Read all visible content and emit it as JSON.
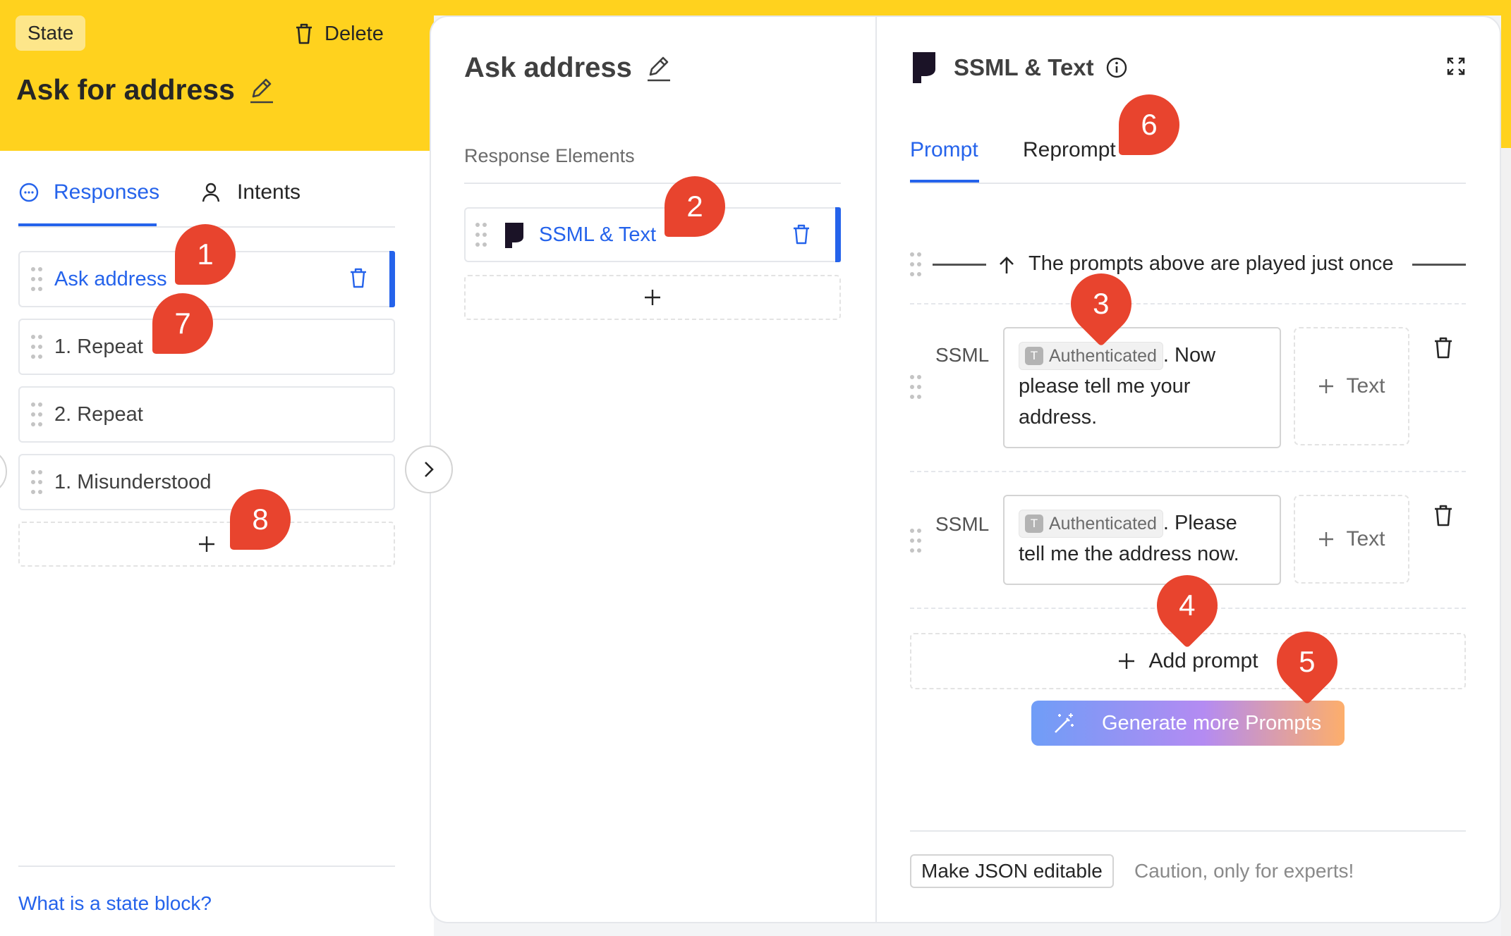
{
  "colors": {
    "yellow": "#ffd21e",
    "blue": "#2563eb",
    "red_pin": "#e8442e",
    "gradient_start": "#6f9df7",
    "gradient_mid": "#b48bf2",
    "gradient_end": "#fdae6b"
  },
  "left": {
    "badge": "State",
    "delete_label": "Delete",
    "title": "Ask for address",
    "tabs": [
      {
        "label": "Responses",
        "active": true,
        "icon": "chat-bubble-icon"
      },
      {
        "label": "Intents",
        "active": false,
        "icon": "user-icon"
      }
    ],
    "items": [
      {
        "label": "Ask address",
        "selected": true
      },
      {
        "label": "1. Repeat",
        "selected": false
      },
      {
        "label": "2. Repeat",
        "selected": false
      },
      {
        "label": "1. Misunderstood",
        "selected": false
      }
    ],
    "help_link": "What is a state block?"
  },
  "middle": {
    "title": "Ask address",
    "section_label": "Response Elements",
    "element_label": "SSML & Text"
  },
  "right": {
    "title": "SSML & Text",
    "tabs": [
      {
        "label": "Prompt",
        "active": true
      },
      {
        "label": "Reprompt",
        "active": false
      }
    ],
    "divider_text": "The prompts above are played just once",
    "prompts": [
      {
        "type": "SSML",
        "chip": "Authenticated",
        "chip_letter": "T",
        "text_first": ". Now",
        "text_rest": "please tell me your address.",
        "add_text": "Text"
      },
      {
        "type": "SSML",
        "chip": "Authenticated",
        "chip_letter": "T",
        "text_first": ". Please",
        "text_rest": "tell me the address now.",
        "add_text": "Text"
      }
    ],
    "add_prompt": "Add prompt",
    "generate": "Generate more Prompts",
    "json_button": "Make JSON editable",
    "json_caution": "Caution, only for experts!"
  },
  "markers": [
    "1",
    "2",
    "3",
    "4",
    "5",
    "6",
    "7",
    "8"
  ]
}
